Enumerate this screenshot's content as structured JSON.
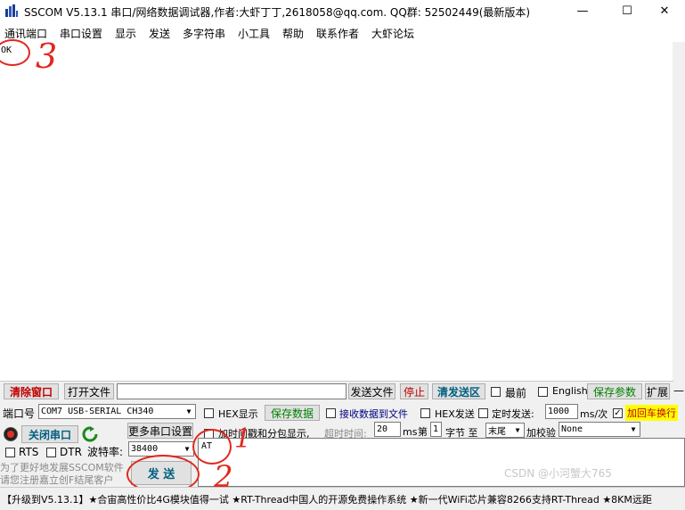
{
  "window": {
    "title": "SSCOM V5.13.1 串口/网络数据调试器,作者:大虾丁丁,2618058@qq.com. QQ群: 52502449(最新版本)",
    "minimize_glyph": "—",
    "maximize_glyph": "☐",
    "close_glyph": "✕"
  },
  "menu": {
    "items": [
      "通讯端口",
      "串口设置",
      "显示",
      "发送",
      "多字符串",
      "小工具",
      "帮助",
      "联系作者",
      "大虾论坛"
    ]
  },
  "receive": {
    "text": "OK"
  },
  "annotations": {
    "n1": "1",
    "n2": "2",
    "n3": "3",
    "color": "#e0281e"
  },
  "toolbar": {
    "clear_window": "清除窗口",
    "open_file": "打开文件",
    "file_path_value": "",
    "send_file": "发送文件",
    "stop": "停止",
    "clear_send": "清发送区",
    "topmost": "最前",
    "english": "English",
    "save_params": "保存参数",
    "expand": "扩展",
    "collapse": "—"
  },
  "port": {
    "port_label": "端口号",
    "port_value": "COM7 USB-SERIAL CH340",
    "hex_display": "HEX显示",
    "save_data": "保存数据",
    "recv_to_file": "接收数据到文件",
    "hex_send": "HEX发送",
    "timed_send": "定时发送:",
    "interval_value": "1000",
    "interval_unit": "ms/次",
    "add_crlf": "加回车换行",
    "close_port": "关闭串口",
    "more_ports": "更多串口设置",
    "add_timestamp": "加时间戳和分包显示,",
    "timeout_label": "超时时间:",
    "timeout_value": "20",
    "timeout_unit": "ms",
    "seg_label": "第",
    "seg_value": "1",
    "byte_label": "字节 至",
    "end_value": "末尾",
    "checksum_label": "加校验",
    "checksum_value": "None",
    "rts": "RTS",
    "dtr": "DTR",
    "baud_label": "波特率:",
    "baud_value": "38400",
    "send_text": "AT",
    "send_button": "发  送",
    "promo_line1": "为了更好地发展SSCOM软件",
    "promo_line2": "请您注册嘉立创F结尾客户"
  },
  "status": {
    "text": "【升级到V5.13.1】★合宙高性价比4G模块值得一试 ★RT-Thread中国人的开源免费操作系统 ★新一代WiFi芯片兼容8266支持RT-Thread ★8KM远距",
    "watermark": "CSDN @小河蟹大765"
  }
}
